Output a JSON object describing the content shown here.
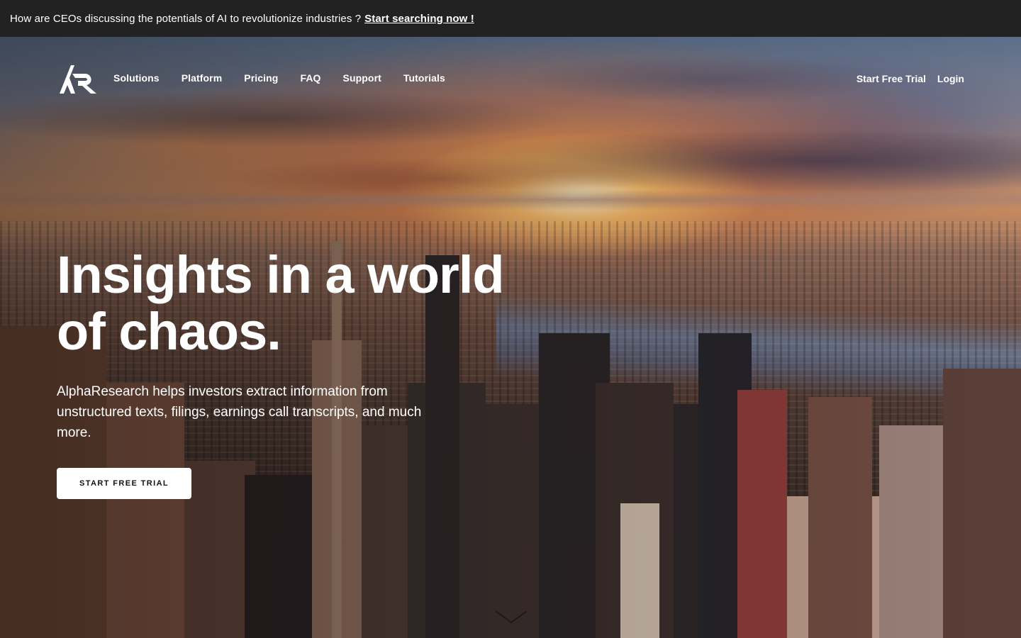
{
  "announcement": {
    "text": "How are CEOs discussing the potentials of AI to revolutionize industries ?",
    "link_label": "Start searching now !"
  },
  "nav": {
    "logo_icon": "alpharesearch-ar-logo-icon",
    "items": [
      {
        "label": "Solutions"
      },
      {
        "label": "Platform"
      },
      {
        "label": "Pricing"
      },
      {
        "label": "FAQ"
      },
      {
        "label": "Support"
      },
      {
        "label": "Tutorials"
      }
    ],
    "trial_label": "Start Free Trial",
    "login_label": "Login"
  },
  "hero": {
    "headline_line1": "Insights in a world",
    "headline_line2": "of chaos.",
    "subtext": "AlphaResearch helps investors extract information from unstructured texts, filings, earnings call transcripts, and much more.",
    "cta_label": "START FREE TRIAL",
    "scroll_icon": "chevron-down-icon"
  },
  "colors": {
    "announcement_bg": "#222222",
    "text": "#ffffff",
    "cta_bg": "#ffffff",
    "cta_text": "#111111"
  }
}
